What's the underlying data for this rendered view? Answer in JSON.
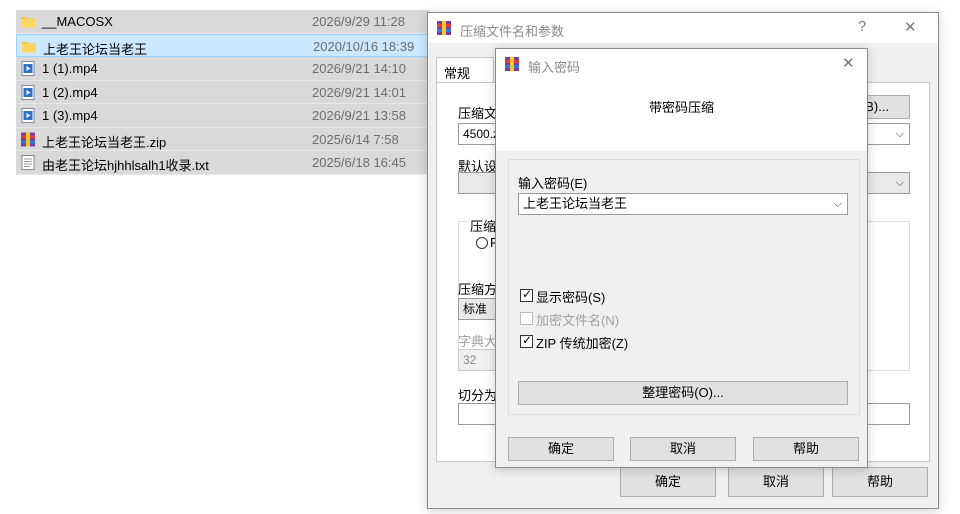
{
  "files": [
    {
      "name": "__MACOSX",
      "date": "2026/9/29 11:28",
      "icon": "folder-icon",
      "selected": false
    },
    {
      "name": "上老王论坛当老王",
      "date": "2020/10/16 18:39",
      "icon": "folder-icon",
      "selected": true
    },
    {
      "name": "1 (1).mp4",
      "date": "2026/9/21 14:10",
      "icon": "video-file-icon",
      "selected": false
    },
    {
      "name": "1 (2).mp4",
      "date": "2026/9/21 14:01",
      "icon": "video-file-icon",
      "selected": false
    },
    {
      "name": "1 (3).mp4",
      "date": "2026/9/21 13:58",
      "icon": "video-file-icon",
      "selected": false
    },
    {
      "name": "上老王论坛当老王.zip",
      "date": "2025/6/14 7:58",
      "icon": "archive-icon",
      "selected": false
    },
    {
      "name": "由老王论坛hjhhlsalh1收录.txt",
      "date": "2025/6/18 16:45",
      "icon": "text-file-icon",
      "selected": false
    }
  ],
  "back_dialog": {
    "title": "压缩文件名和参数",
    "help_glyph": "?",
    "close_glyph": "✕",
    "tab_general": "常规",
    "archive_name_label": "压缩文",
    "archive_name_value": "4500.z",
    "browse_button": "(B)...",
    "default_profile_label": "默认设",
    "format_group_label": "压缩",
    "format_radio_partial": "R",
    "method_label": "压缩方",
    "method_value": "标准",
    "dictionary_label": "字典大",
    "dictionary_value": "32",
    "split_label": "切分为",
    "ok_button": "确定",
    "cancel_button": "取消",
    "help_button": "帮助"
  },
  "password_dialog": {
    "title": "输入密码",
    "close_glyph": "✕",
    "heading": "带密码压缩",
    "password_label": "输入密码(E)",
    "password_value": "上老王论坛当老王",
    "show_password_label": "显示密码(S)",
    "show_password_checked": true,
    "encrypt_filenames_label": "加密文件名(N)",
    "encrypt_filenames_checked": false,
    "zip_legacy_label": "ZIP 传统加密(Z)",
    "zip_legacy_checked": true,
    "organize_button": "整理密码(O)...",
    "ok_button": "确定",
    "cancel_button": "取消",
    "help_button": "帮助"
  },
  "glyphs": {
    "check": "✓",
    "chevron": "⌵"
  }
}
